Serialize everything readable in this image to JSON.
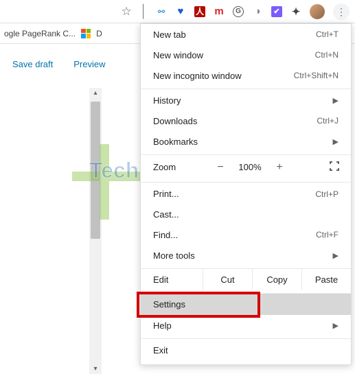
{
  "toolbar": {
    "extensions": [
      "link-icon",
      "y-icon",
      "adobe-icon",
      "m-icon",
      "grammarly-icon",
      "circle-icon",
      "task-icon",
      "puzzle-icon"
    ]
  },
  "bookmarks": {
    "item1": "ogle PageRank C...",
    "item2": "D"
  },
  "page": {
    "save_draft": "Save draft",
    "preview": "Preview"
  },
  "menu": {
    "new_tab": {
      "label": "New tab",
      "shortcut": "Ctrl+T"
    },
    "new_window": {
      "label": "New window",
      "shortcut": "Ctrl+N"
    },
    "new_incognito": {
      "label": "New incognito window",
      "shortcut": "Ctrl+Shift+N"
    },
    "history": {
      "label": "History"
    },
    "downloads": {
      "label": "Downloads",
      "shortcut": "Ctrl+J"
    },
    "bookmarks": {
      "label": "Bookmarks"
    },
    "zoom": {
      "label": "Zoom",
      "minus": "−",
      "value": "100%",
      "plus": "+"
    },
    "print": {
      "label": "Print...",
      "shortcut": "Ctrl+P"
    },
    "cast": {
      "label": "Cast..."
    },
    "find": {
      "label": "Find...",
      "shortcut": "Ctrl+F"
    },
    "more_tools": {
      "label": "More tools"
    },
    "edit": {
      "label": "Edit",
      "cut": "Cut",
      "copy": "Copy",
      "paste": "Paste"
    },
    "settings": {
      "label": "Settings"
    },
    "help": {
      "label": "Help"
    },
    "exit": {
      "label": "Exit"
    }
  },
  "watermark": "Tech Entice"
}
